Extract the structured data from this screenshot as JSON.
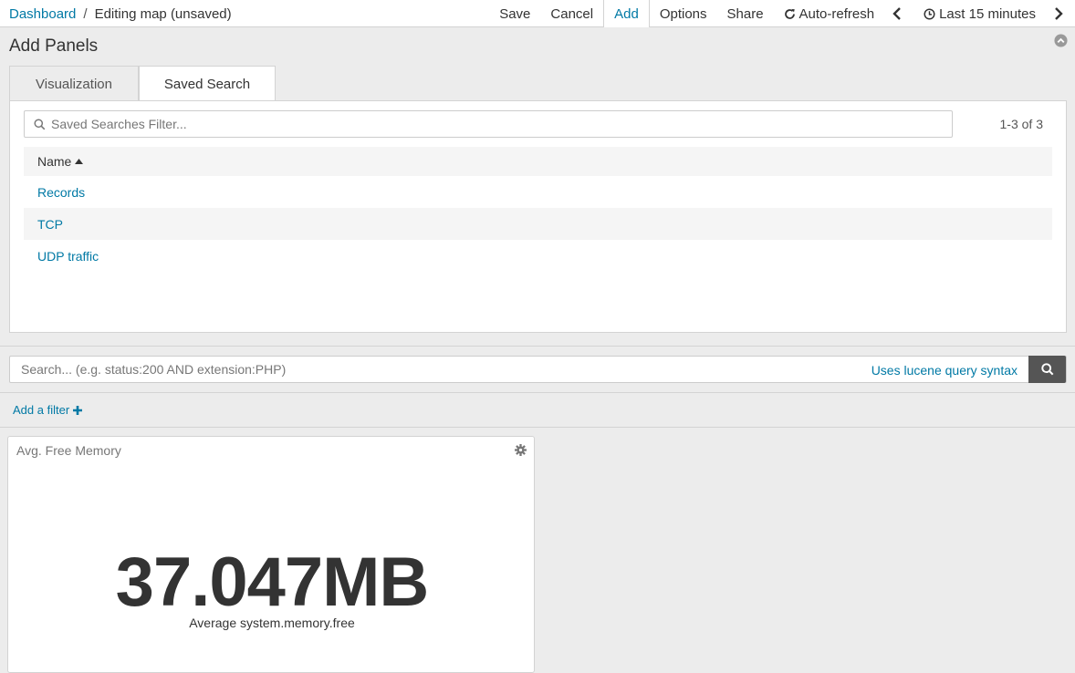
{
  "breadcrumb": {
    "root": "Dashboard",
    "separator": "/",
    "current": "Editing map (unsaved)"
  },
  "topnav": {
    "save": "Save",
    "cancel": "Cancel",
    "add": "Add",
    "options": "Options",
    "share": "Share",
    "autorefresh": "Auto-refresh",
    "timerange": "Last 15 minutes"
  },
  "add_panels": {
    "title": "Add Panels",
    "tabs": [
      {
        "label": "Visualization",
        "active": false
      },
      {
        "label": "Saved Search",
        "active": true
      }
    ],
    "filter_placeholder": "Saved Searches Filter...",
    "count": "1-3 of 3",
    "column_header": "Name",
    "rows": [
      {
        "name": "Records"
      },
      {
        "name": "TCP"
      },
      {
        "name": "UDP traffic"
      }
    ]
  },
  "query": {
    "placeholder": "Search... (e.g. status:200 AND extension:PHP)",
    "syntax_link": "Uses lucene query syntax"
  },
  "filter": {
    "add_label": "Add a filter"
  },
  "panel": {
    "title": "Avg. Free Memory",
    "metric_value": "37.047MB",
    "metric_label": "Average system.memory.free"
  },
  "colors": {
    "link": "#0079a5",
    "button_dark": "#555555",
    "background": "#ececec"
  }
}
